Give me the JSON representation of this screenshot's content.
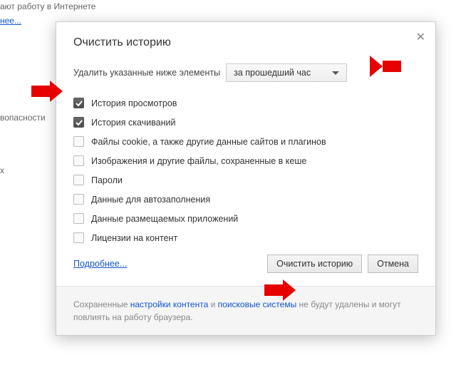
{
  "bg": {
    "line1": "ают работу в Интернете",
    "link1": "нее...",
    "line2": "вопасности",
    "line3": "х"
  },
  "dialog": {
    "title": "Очистить историю",
    "delete_label": "Удалить указанные ниже элементы",
    "timerange": "за прошедший час",
    "checkboxes": [
      {
        "label": "История просмотров",
        "checked": true
      },
      {
        "label": "История скачиваний",
        "checked": true
      },
      {
        "label": "Файлы cookie, а также другие данные сайтов и плагинов",
        "checked": false
      },
      {
        "label": "Изображения и другие файлы, сохраненные в кеше",
        "checked": false
      },
      {
        "label": "Пароли",
        "checked": false
      },
      {
        "label": "Данные для автозаполнения",
        "checked": false
      },
      {
        "label": "Данные размещаемых приложений",
        "checked": false
      },
      {
        "label": "Лицензии на контент",
        "checked": false
      }
    ],
    "more": "Подробнее...",
    "clear_btn": "Очистить историю",
    "cancel_btn": "Отмена",
    "footer_pre": "Сохраненные ",
    "footer_link1": "настройки контента",
    "footer_mid": " и ",
    "footer_link2": "поисковые системы",
    "footer_post": " не будут удалены и могут повлиять на работу браузера."
  }
}
